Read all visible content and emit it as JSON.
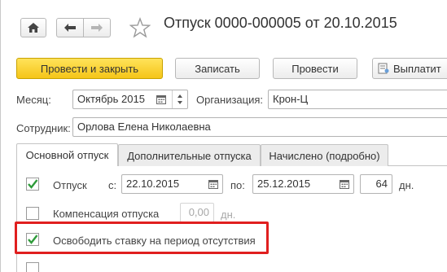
{
  "window": {
    "title": "Отпуск 0000-000005 от 20.10.2015"
  },
  "toolbar": {
    "post_close_label": "Провести и закрыть",
    "save_label": "Записать",
    "post_label": "Провести",
    "pay_label": "Выплатит"
  },
  "form": {
    "month_label": "Месяц:",
    "month_value": "Октябрь 2015",
    "org_label": "Организация:",
    "org_value": "Крон-Ц",
    "employee_label": "Сотрудник:",
    "employee_value": "Орлова Елена Николаевна"
  },
  "tabs": [
    {
      "label": "Основной отпуск",
      "active": true
    },
    {
      "label": "Дополнительные отпуска",
      "active": false
    },
    {
      "label": "Начислено (подробно)",
      "active": false
    }
  ],
  "vacation": {
    "checked": true,
    "label": "Отпуск",
    "from_label": "с:",
    "from_value": "22.10.2015",
    "to_label": "по:",
    "to_value": "25.12.2015",
    "days_value": "64",
    "days_unit": "дн."
  },
  "compensation": {
    "checked": false,
    "label": "Компенсация отпуска",
    "days_value": "0,00",
    "days_unit": "дн."
  },
  "free_rate": {
    "checked": true,
    "label": "Освободить ставку на период отсутствия"
  },
  "colors": {
    "primary_button": "#f5c518",
    "highlight_border": "#e01f1f",
    "check_mark": "#2e9b3a"
  }
}
